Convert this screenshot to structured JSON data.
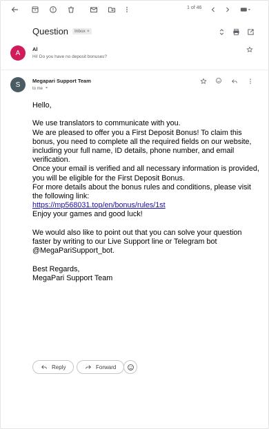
{
  "toolbar": {
    "icons": [
      "back-arrow-icon",
      "archive-icon",
      "report-spam-icon",
      "delete-icon",
      "mark-unread-icon",
      "move-to-icon",
      "more-vert-icon"
    ],
    "pager": "1 of 46"
  },
  "thread": {
    "subject": "Question",
    "label": "Inbox",
    "label_remove": "×"
  },
  "message1": {
    "avatar_letter": "A",
    "avatar_color": "#d01c5b",
    "sender": "Al",
    "snippet": "Hi! Do you have no deposit bonuses?"
  },
  "message2": {
    "avatar_letter": "S",
    "avatar_color": "#4b5b64",
    "sender": "Megapari Support Team",
    "to": "to me",
    "body": {
      "greeting": "Hello,",
      "p1_line1": "We use translators to communicate with you.",
      "p1_line2": "We are pleased to offer you a First Deposit Bonus! To claim this bonus, you need to complete all the required fields on our website, including your full name, ID details, phone number, and email verification.",
      "p1_line3": "Once your email is verified and all necessary information is provided, you will be eligible for the First Deposit Bonus.",
      "p1_line4": "For more details about the bonus rules and conditions, please visit the following link:",
      "link": "https://mp568031.top/en/bonus/rules/1st",
      "p1_line5": "Enjoy your games and good luck!",
      "p2": "We would also like to point out that you can solve your question faster by writing to our Live Support line or Telegram bot @MegaPariSupport_bot.",
      "sign1": "Best Regards,",
      "sign2": "MegaPari Support Team"
    }
  },
  "actions": {
    "reply": "Reply",
    "forward": "Forward"
  }
}
